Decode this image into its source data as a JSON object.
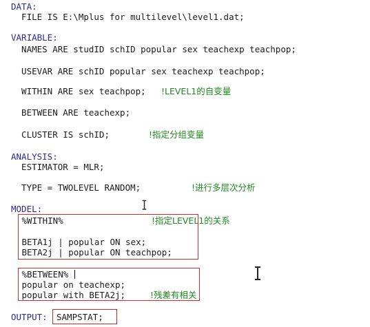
{
  "lines": {
    "data_kw": "DATA:",
    "file": "  FILE IS E:\\Mplus for multilevel\\level1.dat;",
    "variable_kw": "VARIABLE:",
    "names": "  NAMES ARE studID schID popular sex teachexp teachpop;",
    "usevar": "  USEVAR ARE schID popular sex teachexp teachpop;",
    "within_code": "  WITHIN ARE sex teachpop;",
    "within_comment": "!LEVEL1的自变量",
    "between": "  BETWEEN ARE teachexp;",
    "cluster_code": "  CLUSTER IS schID;",
    "cluster_comment": "!指定分组变量",
    "analysis_kw": "ANALYSIS:",
    "estimator": "  ESTIMATOR = MLR;",
    "type_code": "  TYPE = TWOLEVEL RANDOM;",
    "type_comment": "!进行多层次分析",
    "model_kw": "MODEL:",
    "within_section": " %WITHIN%",
    "within_section_comment": "!指定LEVEL1的关系",
    "beta1": " BETA1j | popular ON sex;",
    "beta2": " BETA2j | popular ON teachpop;",
    "between_section": " %BETWEEN%",
    "pop_on": " popular on teachexp;",
    "pop_with": " popular with BETA2j;",
    "pop_with_comment": "!残差有相关",
    "output_kw": "OUTPUT:",
    "output_value": "SAMPSTAT;"
  },
  "colors": {
    "keyword": "#2a2a8f",
    "comment": "#1f8a1f",
    "highlight_box": "#d42a2a"
  }
}
